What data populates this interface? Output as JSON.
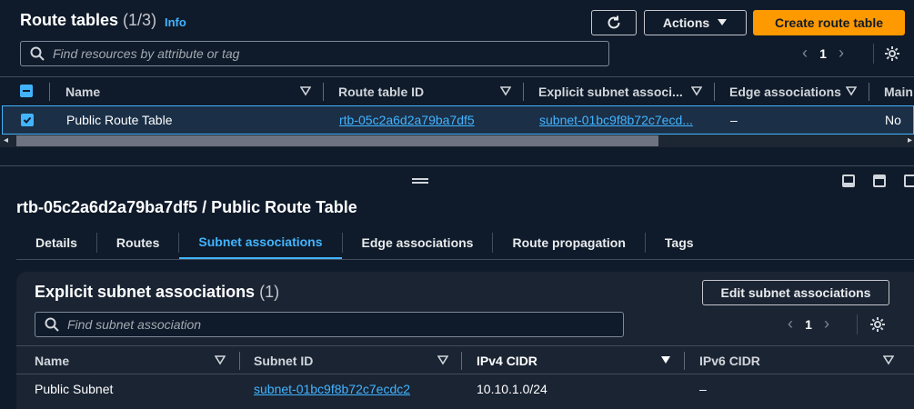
{
  "header": {
    "title": "Route tables",
    "count": "(1/3)",
    "info": "Info",
    "refresh_icon": "refresh-icon",
    "actions_label": "Actions",
    "create_label": "Create route table",
    "search_placeholder": "Find resources by attribute or tag",
    "page": "1"
  },
  "table": {
    "columns": [
      "Name",
      "Route table ID",
      "Explicit subnet associ...",
      "Edge associations",
      "Main"
    ],
    "rows": [
      {
        "selected": true,
        "name": "Public Route Table",
        "route_table_id": "rtb-05c2a6d2a79ba7df5",
        "explicit_subnet": "subnet-01bc9f8b72c7ecd...",
        "edge": "–",
        "main": "No"
      }
    ]
  },
  "detail": {
    "title": "rtb-05c2a6d2a79ba7df5 / Public Route Table",
    "tabs": [
      "Details",
      "Routes",
      "Subnet associations",
      "Edge associations",
      "Route propagation",
      "Tags"
    ],
    "active_tab": "Subnet associations"
  },
  "subnet_card": {
    "title": "Explicit subnet associations",
    "count": "(1)",
    "edit_label": "Edit subnet associations",
    "search_placeholder": "Find subnet association",
    "page": "1",
    "columns": [
      "Name",
      "Subnet ID",
      "IPv4 CIDR",
      "IPv6 CIDR"
    ],
    "rows": [
      {
        "name": "Public Subnet",
        "subnet_id": "subnet-01bc9f8b72c7ecdc2",
        "ipv4": "10.10.1.0/24",
        "ipv6": "–"
      }
    ]
  },
  "colors": {
    "accent": "#42b4ff",
    "primary_button": "#ff9900",
    "background": "#0f1b2a"
  }
}
